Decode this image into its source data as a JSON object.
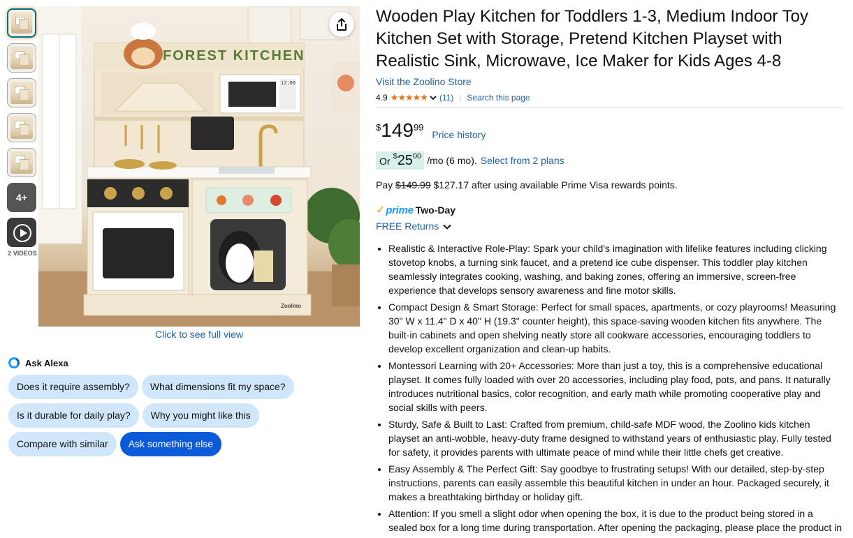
{
  "gallery": {
    "thumb_count_label": "4+",
    "videos_label": "2 VIDEOS",
    "full_view_label": "Click to see full view",
    "image_text": {
      "sign": "FOREST KITCHEN",
      "brand": "Zoolino",
      "clock": "12:00"
    }
  },
  "alexa": {
    "title": "Ask Alexa",
    "chips": [
      "Does it require assembly?",
      "What dimensions fit my space?",
      "Is it durable for daily play?",
      "Why you might like this",
      "Compare with similar",
      "Ask something else"
    ]
  },
  "product": {
    "title": "Wooden Play Kitchen for Toddlers 1-3, Medium Indoor Toy Kitchen Set with Storage, Pretend Kitchen Playset with Realistic Sink, Microwave, Ice Maker for Kids Ages 4-8",
    "store_link": "Visit the Zoolino Store",
    "rating": "4.9",
    "stars": "★★★★★",
    "rating_count": "(11)",
    "search_page": "Search this page",
    "price": {
      "symbol": "$",
      "whole": "149",
      "fraction": "99",
      "history_label": "Price history"
    },
    "monthly": {
      "or": "Or",
      "symbol": "$",
      "whole": "25",
      "fraction": "00",
      "period": "/mo (6 mo).",
      "plans_link": "Select from 2 plans"
    },
    "pay": {
      "prefix": "Pay",
      "original": "$149.99",
      "rest": "$127.17 after using available Prime Visa rewards points."
    },
    "delivery": {
      "check": "✓",
      "prime": "prime",
      "speed": "Two-Day",
      "returns": "FREE Returns"
    },
    "bullets": [
      "Realistic & Interactive Role-Play: Spark your child's imagination with lifelike features including clicking stovetop knobs, a turning sink faucet, and a pretend ice cube dispenser. This toddler play kitchen seamlessly integrates cooking, washing, and baking zones, offering an immersive, screen-free experience that develops sensory awareness and fine motor skills.",
      "Compact Design & Smart Storage: Perfect for small spaces, apartments, or cozy playrooms! Measuring 30\" W x 11.4\" D x 40\" H (19.3\" counter height), this space-saving wooden kitchen fits anywhere. The built-in cabinets and open shelving neatly store all cookware accessories, encouraging toddlers to develop excellent organization and clean-up habits.",
      "Montessori Learning with 20+ Accessories: More than just a toy, this is a comprehensive educational playset. It comes fully loaded with over 20 accessories, including play food, pots, and pans. It naturally introduces nutritional basics, color recognition, and early math while promoting cooperative play and social skills with peers.",
      "Sturdy, Safe & Built to Last: Crafted from premium, child-safe MDF wood, the Zoolino kids kitchen playset an anti-wobble, heavy-duty frame designed to withstand years of enthusiastic play. Fully tested for safety, it provides parents with ultimate peace of mind while their little chefs get creative.",
      "Easy Assembly & The Perfect Gift: Say goodbye to frustrating setups! With our detailed, step-by-step instructions, parents can easily assemble this beautiful kitchen in under an hour. Packaged securely, it makes a breathtaking birthday or holiday gift.",
      "Attention: If you smell a slight odor when opening the box, it is due to the product being stored in a sealed box for a long time during transportation. After opening the packaging, please place the product in a well-ventilated area. Kitchen toy playset come with assembly instructions. If there are any"
    ]
  },
  "colors": {
    "link": "#2162a1",
    "star": "#de7921",
    "prime_blue": "#1a98ff",
    "chip_bg": "#cfe6fb",
    "chip_primary": "#0b5ad9",
    "deal_bg": "#d7f1ea"
  }
}
